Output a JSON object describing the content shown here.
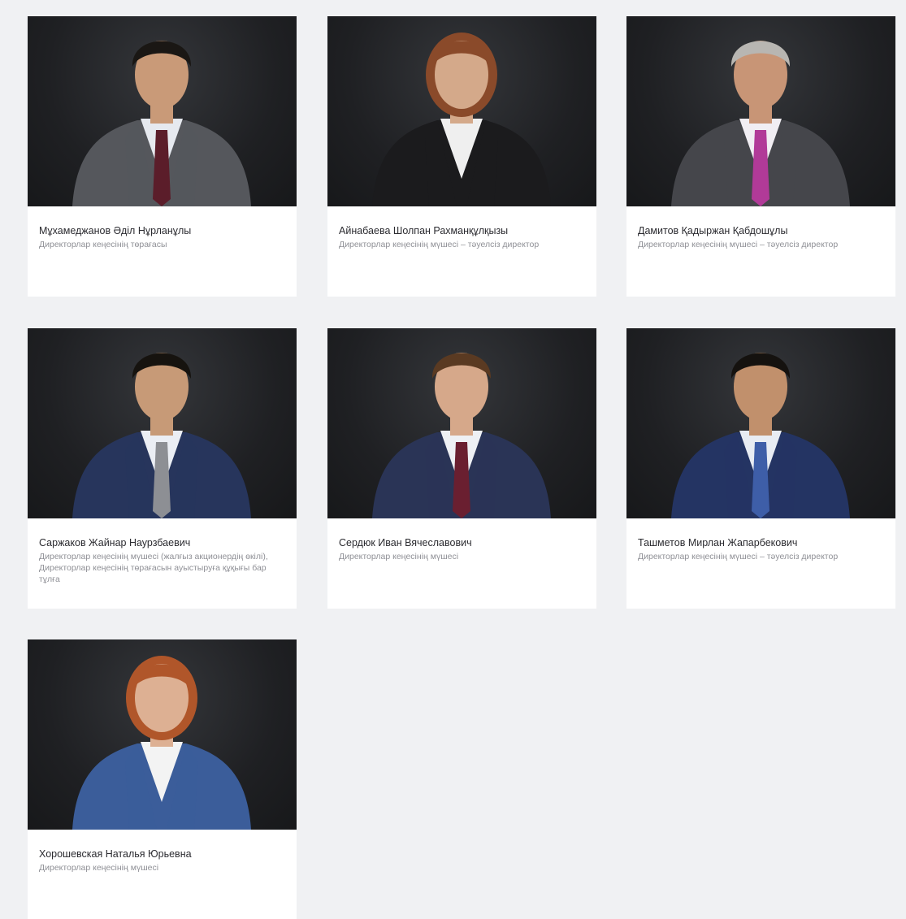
{
  "board": {
    "members": [
      {
        "name": "Мұхамеджанов Әділ Нұрланұлы",
        "role": "Директорлар кеңесінің төрағасы",
        "colors": {
          "skin": "#c99a78",
          "hair": "#1a1714",
          "suit": "#55575c",
          "shirt": "#e6e9ef",
          "tie": "#5b1d2a"
        }
      },
      {
        "name": "Айнабаева Шолпан Рахманқұлқызы",
        "role": "Директорлар кеңесінің мүшесі – тәуелсіз директор",
        "colors": {
          "skin": "#d4a98a",
          "hair": "#8a4a2a",
          "suit": "#1b1b1d",
          "shirt": "#efefef",
          "tie": ""
        }
      },
      {
        "name": "Дамитов Қадыржан Қабдошұлы",
        "role": "Директорлар кеңесінің мүшесі – тәуелсіз директор",
        "colors": {
          "skin": "#c89576",
          "hair": "#b8b6b2",
          "suit": "#45464b",
          "shirt": "#f1eef3",
          "tie": "#b13a98"
        }
      },
      {
        "name": "Саржаков Жайнар Наурзбаевич",
        "role": "Директорлар кеңесінің мүшесі (жалғыз акционердің өкілі), Директорлар кеңесінің төрағасын ауыстыруға құқығы бар тұлға",
        "colors": {
          "skin": "#c79a77",
          "hair": "#16130f",
          "suit": "#27355c",
          "shirt": "#ebeef4",
          "tie": "#8d8f94"
        }
      },
      {
        "name": "Сердюк Иван Вячеславович",
        "role": "Директорлар кеңесінің мүшесі",
        "colors": {
          "skin": "#d6a88a",
          "hair": "#5a3a22",
          "suit": "#2a3456",
          "shirt": "#eef0f4",
          "tie": "#6a1f30"
        }
      },
      {
        "name": "Ташметов Мирлан Жапарбекович",
        "role": "Директорлар кеңесінің мүшесі – тәуелсіз директор",
        "colors": {
          "skin": "#c1906c",
          "hair": "#15120f",
          "suit": "#243463",
          "shirt": "#e8ecf3",
          "tie": "#3e5ea8"
        }
      },
      {
        "name": "Хорошевская Наталья Юрьевна",
        "role": "Директорлар кеңесінің мүшесі",
        "colors": {
          "skin": "#ddb093",
          "hair": "#b0562a",
          "suit": "#3b5d9a",
          "shirt": "#f3f3f3",
          "tie": ""
        }
      }
    ]
  }
}
